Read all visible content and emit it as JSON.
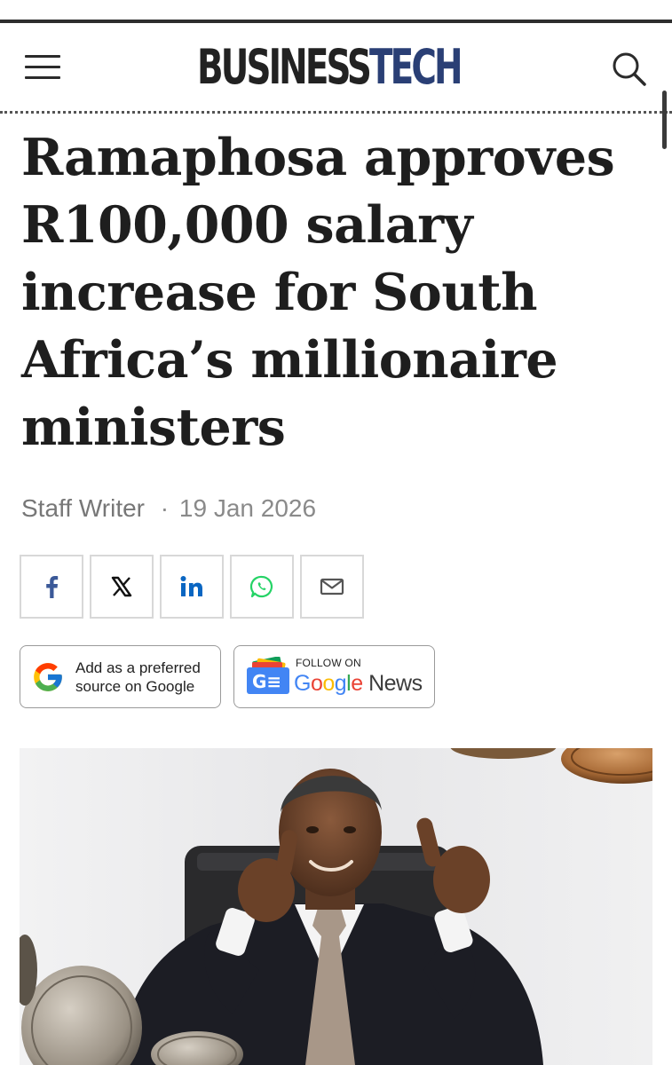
{
  "header": {
    "logo_part1": "BUSINESS",
    "logo_part2": "TECH",
    "menu_icon": "hamburger-menu-icon",
    "search_icon": "search-icon"
  },
  "article": {
    "headline_lines": [
      "Ramaphosa approves",
      "R100,000 salary",
      "increase for South",
      "Africa’s millionaire",
      "ministers"
    ],
    "author": "Staff Writer",
    "separator": "·",
    "date": "19 Jan 2026"
  },
  "share": {
    "facebook_icon": "facebook-icon",
    "x_icon": "x-icon",
    "linkedin_icon": "linkedin-icon",
    "whatsapp_icon": "whatsapp-icon",
    "email_icon": "email-icon"
  },
  "google_preferred": {
    "line1": "Add as a preferred",
    "line2": "source on Google"
  },
  "google_news": {
    "small_text": "FOLLOW ON",
    "brand_letters": [
      "G",
      "o",
      "o",
      "g",
      "l",
      "e"
    ],
    "news_text": "News",
    "badge_text": "G≡"
  },
  "colors": {
    "logo_dark": "#222222",
    "logo_accent": "#2a3f75",
    "facebook": "#3b5998",
    "linkedin": "#0a66c2",
    "whatsapp": "#25d366"
  }
}
